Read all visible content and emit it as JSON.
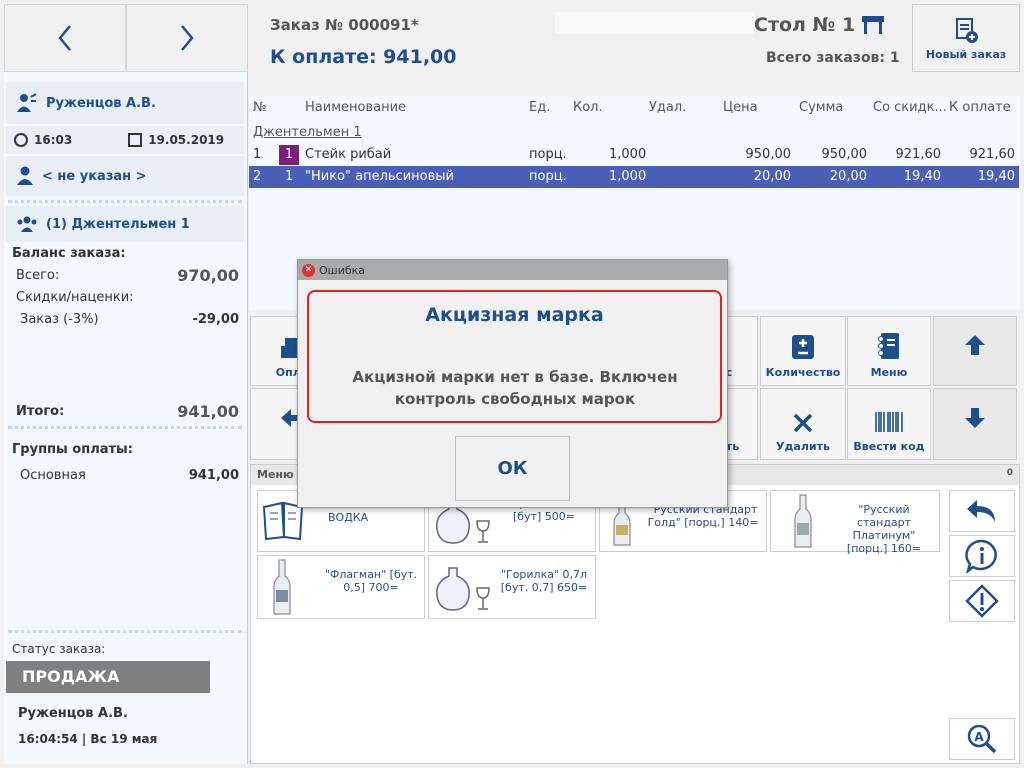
{
  "nav": {
    "back_icon": "chevron-left-icon",
    "forward_icon": "chevron-right-icon"
  },
  "header": {
    "order_title": "Заказ № 000091*",
    "to_pay": "К оплате: 941,00",
    "table": "Стол № 1",
    "total_orders": "Всего заказов: 1",
    "new_order": "Новый заказ"
  },
  "sidebar": {
    "waiter": "Руженцов А.В.",
    "time": "16:03",
    "date": "19.05.2019",
    "client": "< не указан >",
    "guest": "(1) Джентельмен 1",
    "balance_title": "Баланс заказа:",
    "total_label": "Всего:",
    "total_value": "970,00",
    "discounts_label": "Скидки/наценки:",
    "order_disc_label": "Заказ (-3%)",
    "order_disc_value": "-29,00",
    "result_label": "Итого:",
    "result_value": "941,00",
    "pay_groups_label": "Группы оплаты:",
    "pay_group_name": "Основная",
    "pay_group_value": "941,00",
    "status_label": "Статус заказа:",
    "status_value": "ПРОДАЖА",
    "footer_user": "Руженцов А.В.",
    "footer_time": "16:04:54  |  Вс 19 мая"
  },
  "table": {
    "headers": [
      "№",
      "Наименование",
      "Ед.",
      "Кол.",
      "Удал.",
      "Цена",
      "Сумма",
      "Со скидк...",
      "К оплате"
    ],
    "group": "Джентельмен 1",
    "rows": [
      {
        "n": "1",
        "course": "1",
        "name": "Стейк рибай",
        "unit": "порц.",
        "qty": "1,000",
        "price": "950,00",
        "sum": "950,00",
        "disc": "921,60",
        "pay": "921,60"
      },
      {
        "n": "2",
        "course": "1",
        "name": "\"Нико\" апельсиновый",
        "unit": "порц.",
        "qty": "1,000",
        "price": "20,00",
        "sum": "20,00",
        "disc": "19,40",
        "pay": "19,40"
      }
    ]
  },
  "actions": {
    "pay_partial": "Опла",
    "qty": "Количество",
    "menu": "Меню",
    "s_partial": "с",
    "delete_partial": "уть",
    "delete": "Удалить",
    "enter_code": "Ввести код"
  },
  "menu_panel": {
    "title": "Меню",
    "count": "0"
  },
  "products": [
    {
      "text": "ВОДКА"
    },
    {
      "text": "\"Горилка\" 0,5л [бут] 500="
    },
    {
      "text": "\"Русский стандарт Голд\" [порц.] 140="
    },
    {
      "text": "\"Русский стандарт Платинум\" [порц.] 160="
    },
    {
      "text": "\"Флагман\" [бут. 0,5] 700="
    },
    {
      "text": "\"Горилка\" 0,7л [бут. 0,7] 650="
    }
  ],
  "dialog": {
    "title": "Ошибка",
    "heading": "Акцизная марка",
    "message": "Акцизной марки нет в базе. Включен контроль свободных марок",
    "ok": "ОК"
  },
  "colors": {
    "accent": "#1f4e8c",
    "selected_row": "#4a5fb5",
    "error_border": "#e02020",
    "status_bg": "#7f7f7f",
    "course_badge": "#7a1f7a"
  }
}
